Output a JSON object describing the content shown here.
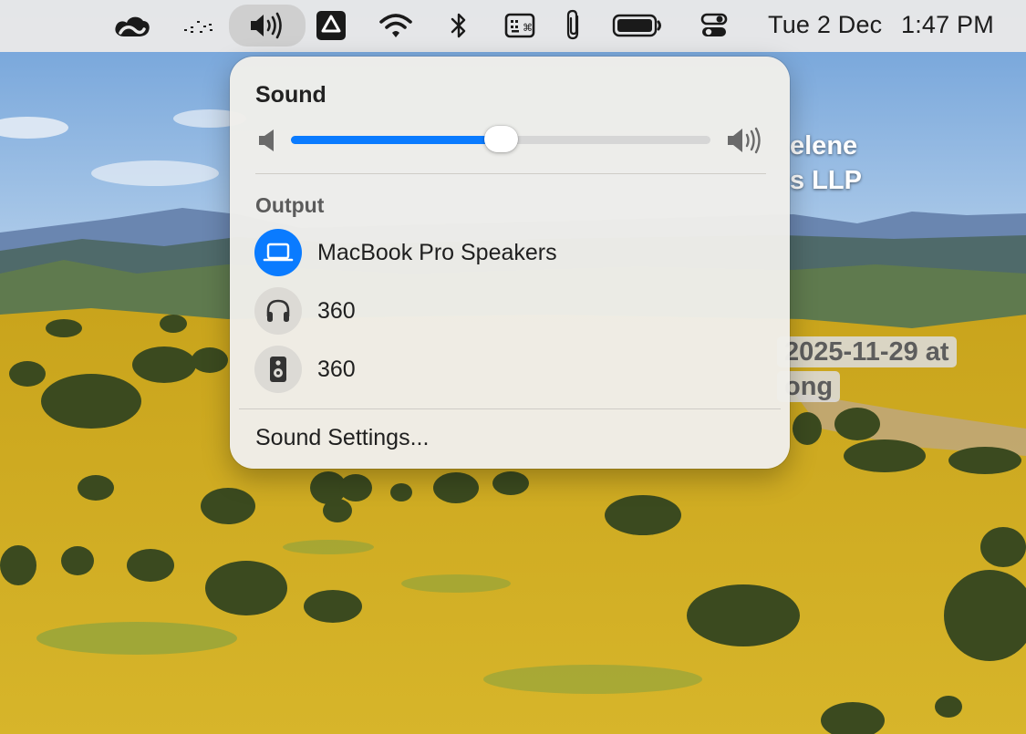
{
  "menubar": {
    "icons": [
      "creative-cloud-icon",
      "dots-icon",
      "speaker-icon",
      "google-drive-icon",
      "wifi-icon",
      "bluetooth-icon",
      "keyboard-icon",
      "paperclip-icon",
      "battery-icon",
      "control-center-icon"
    ],
    "date": "Tue 2 Dec",
    "time": "1:47 PM"
  },
  "desktop": {
    "label_line1": "elene",
    "label_line2": "s LLP",
    "file_line1": "2025-11-29 at",
    "file_line2": "ong"
  },
  "sound_menu": {
    "title": "Sound",
    "volume_fraction": 0.5,
    "output_label": "Output",
    "devices": [
      {
        "name": "MacBook Pro Speakers",
        "icon": "laptop-icon",
        "selected": true
      },
      {
        "name": "360",
        "icon": "headphones-icon",
        "selected": false
      },
      {
        "name": "360",
        "icon": "speaker-box-icon",
        "selected": false
      }
    ],
    "settings_label": "Sound Settings..."
  },
  "colors": {
    "accent": "#0a7bff",
    "menubar_bg": "#e8e8e8",
    "popover_bg": "#f0eeea"
  }
}
